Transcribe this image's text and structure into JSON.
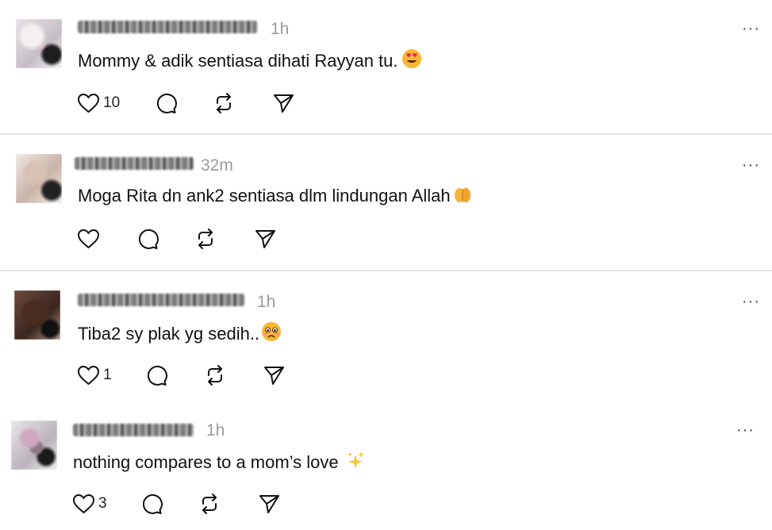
{
  "comments": [
    {
      "time": "1h",
      "text": "Mommy & adik sentiasa dihati Rayyan tu.",
      "emoji": "smiling-face-with-heart-eyes",
      "like_count": "10"
    },
    {
      "time": "32m",
      "text": "Moga Rita dn ank2 sentiasa dlm lindungan Allah",
      "emoji": "praying-hands",
      "like_count": ""
    },
    {
      "time": "1h",
      "text": "Tiba2 sy plak yg sedih..",
      "emoji": "sad-face",
      "like_count": "1"
    },
    {
      "time": "1h",
      "text": "nothing compares to a mom’s love",
      "emoji": "sparkles",
      "like_count": "3"
    }
  ],
  "more_glyph": "···",
  "colors": {
    "text": "#111111",
    "muted": "#9a9a9a",
    "divider": "#e3e3e3",
    "heart_eyes_face": "#f7b733",
    "sparkles": "#f5c542"
  },
  "icons": [
    "heart-icon",
    "comment-icon",
    "repost-icon",
    "share-icon",
    "more-icon"
  ]
}
